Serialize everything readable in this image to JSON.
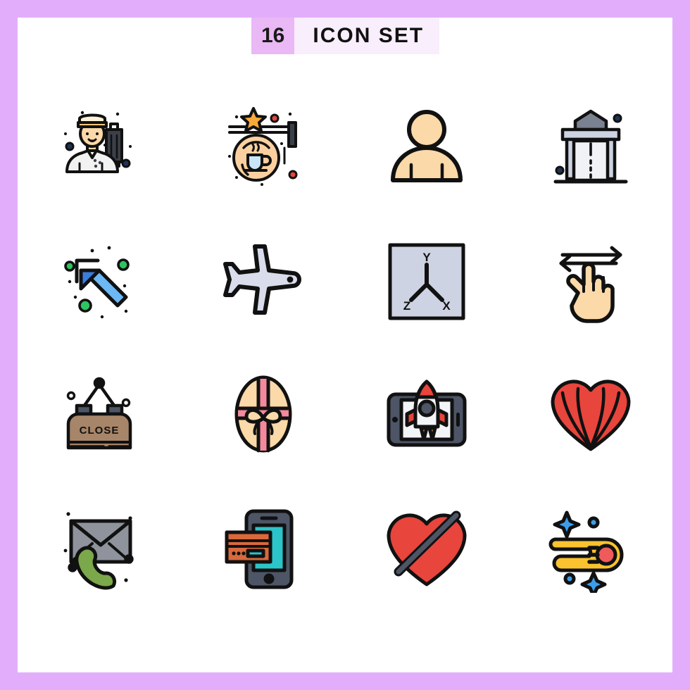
{
  "header": {
    "count": "16",
    "title": "ICON SET"
  },
  "palette": {
    "page_border": "#e2aefb",
    "page_background": "#ffffff",
    "badge_background": "#eab8f5",
    "title_background": "#f9eefc",
    "outline": "#111111",
    "skin": "#fcd9a8",
    "peach": "#fbd9a8",
    "red": "#e8453c",
    "blue": "#3b7ddd",
    "light_blue": "#6cb8f5",
    "green": "#2ec45f",
    "dark_green": "#7aa84a",
    "yellow": "#f9c22e",
    "orange": "#f5a96a",
    "gray": "#7a8190",
    "light_gray": "#eceef3",
    "lavender_gray": "#ced3e3",
    "brown": "#a78568",
    "teal": "#2bc4c9",
    "pink": "#f4899d",
    "navy": "#2b3a55",
    "dot_navy": "#1d3557"
  },
  "icons": [
    {
      "id": 1,
      "name": "bellboy-with-luggage",
      "label": "Bellboy with luggage",
      "row": 1,
      "col": 1
    },
    {
      "id": 2,
      "name": "coffee-shop-sign",
      "label": "Coffee shop hanging sign",
      "row": 1,
      "col": 2
    },
    {
      "id": 3,
      "name": "user-avatar",
      "label": "User avatar",
      "row": 1,
      "col": 3
    },
    {
      "id": 4,
      "name": "building-entrance",
      "label": "Building entrance",
      "row": 1,
      "col": 4
    },
    {
      "id": 5,
      "name": "arrow-up-left",
      "label": "Arrow pointing up left",
      "row": 2,
      "col": 1
    },
    {
      "id": 6,
      "name": "airplane",
      "label": "Airplane",
      "row": 2,
      "col": 2
    },
    {
      "id": 7,
      "name": "xyz-axis",
      "label": "XYZ coordinate axis",
      "row": 2,
      "col": 3,
      "axis_labels": {
        "y": "Y",
        "z": "Z",
        "x": "X"
      }
    },
    {
      "id": 8,
      "name": "swipe-horizontal-gesture",
      "label": "Three finger horizontal swipe",
      "row": 2,
      "col": 4
    },
    {
      "id": 9,
      "name": "close-sign",
      "label": "Hanging close sign",
      "row": 3,
      "col": 1,
      "sign_text": "CLOSE"
    },
    {
      "id": 10,
      "name": "easter-egg",
      "label": "Decorated easter egg",
      "row": 3,
      "col": 2
    },
    {
      "id": 11,
      "name": "mobile-rocket-launch",
      "label": "Rocket launching from smartphone",
      "row": 3,
      "col": 3
    },
    {
      "id": 12,
      "name": "striped-heart",
      "label": "Striped heart",
      "row": 3,
      "col": 4
    },
    {
      "id": 13,
      "name": "mail-phone-contact",
      "label": "Envelope with phone handset",
      "row": 4,
      "col": 1
    },
    {
      "id": 14,
      "name": "mobile-card-payment",
      "label": "Mobile credit card payment",
      "row": 4,
      "col": 2
    },
    {
      "id": 15,
      "name": "heart-slash",
      "label": "Heart with slash",
      "row": 4,
      "col": 3
    },
    {
      "id": 16,
      "name": "comet",
      "label": "Comet with sparkles",
      "row": 4,
      "col": 4
    }
  ]
}
